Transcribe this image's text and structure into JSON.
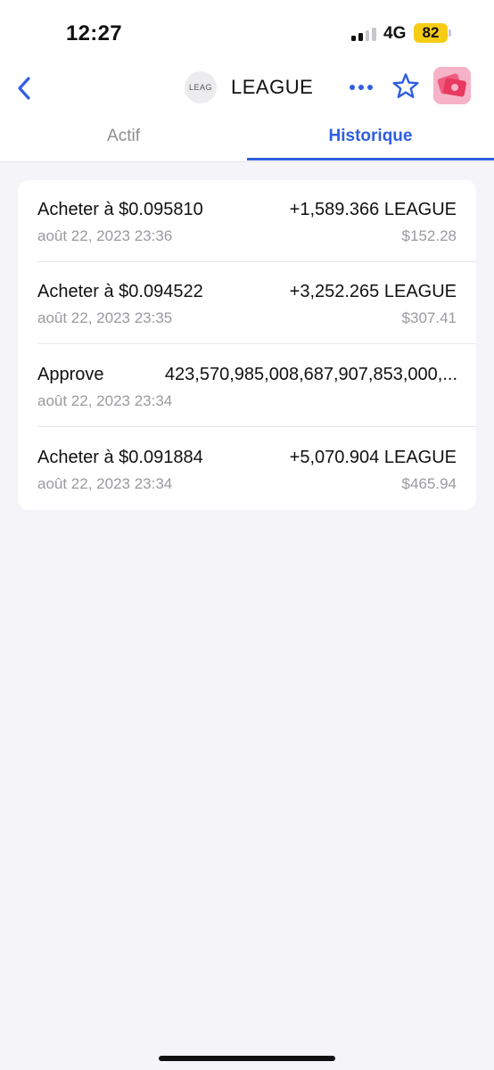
{
  "status_bar": {
    "time": "12:27",
    "network": "4G",
    "battery": "82",
    "battery_color": "#f7cc14"
  },
  "nav": {
    "back_icon": "chevron-left-icon",
    "token_logo_text": "LEAG",
    "title": "LEAGUE",
    "more_icon": "more-horizontal-icon",
    "star_icon": "star-outline-icon",
    "avatar_icon": "avatar",
    "accent_color": "#2f5ee0"
  },
  "tabs": {
    "items": [
      {
        "label": "Actif",
        "active": false
      },
      {
        "label": "Historique",
        "active": true
      }
    ]
  },
  "history": {
    "items": [
      {
        "title": "Acheter à $0.095810",
        "date": "août 22, 2023 23:36",
        "amount": "+1,589.366 LEAGUE",
        "value": "$152.28"
      },
      {
        "title": "Acheter à $0.094522",
        "date": "août 22, 2023 23:35",
        "amount": "+3,252.265 LEAGUE",
        "value": "$307.41"
      },
      {
        "title": "Approve",
        "date": "août 22, 2023 23:34",
        "amount": "423,570,985,008,687,907,853,000,...",
        "value": ""
      },
      {
        "title": "Acheter à $0.091884",
        "date": "août 22, 2023 23:34",
        "amount": "+5,070.904 LEAGUE",
        "value": "$465.94"
      }
    ]
  }
}
